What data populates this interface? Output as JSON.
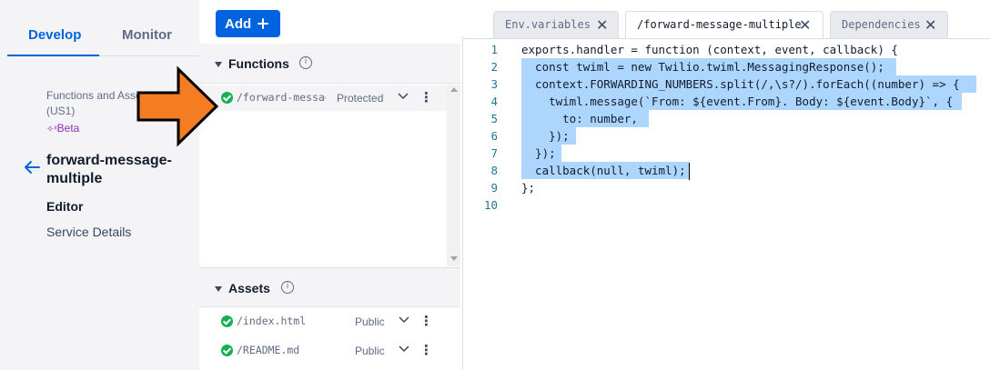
{
  "nav": {
    "tabs": [
      {
        "label": "Develop",
        "active": true
      },
      {
        "label": "Monitor",
        "active": false
      }
    ],
    "service_name": "Functions and Assets",
    "service_region": "(US1)",
    "beta_label": "Beta",
    "function_title": "forward-message-multiple",
    "items": [
      {
        "label": "Editor",
        "active": true
      },
      {
        "label": "Service Details",
        "active": false
      }
    ]
  },
  "toolbar": {
    "add_label": "Add",
    "add_icon": "plus-icon"
  },
  "functions": {
    "title": "Functions",
    "items": [
      {
        "name": "/forward-message-multiple",
        "visibility": "Protected",
        "status": "deployed"
      }
    ]
  },
  "assets": {
    "title": "Assets",
    "items": [
      {
        "name": "/index.html",
        "visibility": "Public",
        "status": "deployed"
      },
      {
        "name": "/README.md",
        "visibility": "Public",
        "status": "deployed"
      }
    ]
  },
  "editor": {
    "tabs": [
      {
        "label": "Env.variables",
        "active": false
      },
      {
        "label": "/forward-message-multiple",
        "active": true
      },
      {
        "label": "Dependencies",
        "active": false
      }
    ],
    "line_numbers": [
      "1",
      "2",
      "3",
      "4",
      "5",
      "6",
      "7",
      "8",
      "9",
      "10"
    ],
    "code_lines": [
      "exports.handler = function (context, event, callback) {",
      "  const twiml = new Twilio.twiml.MessagingResponse();",
      "  context.FORWARDING_NUMBERS.split(/,\\s?/).forEach((number) => {",
      "    twiml.message(`From: ${event.From}. Body: ${event.Body}`, {",
      "      to: number,",
      "    });",
      "  });",
      "  callback(null, twiml);",
      "};",
      ""
    ]
  },
  "colors": {
    "accent": "#0263e0",
    "success": "#14b053",
    "annotation_arrow": "#f47c22",
    "selection": "#add6ff"
  }
}
